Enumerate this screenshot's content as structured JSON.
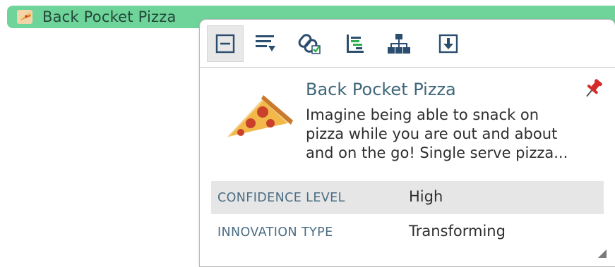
{
  "topic": {
    "title": "Back Pocket Pizza",
    "pill_color": "#6fd49a",
    "icon": "pizza-slice-icon"
  },
  "toolbar": {
    "tools": [
      {
        "icon": "collapse-icon",
        "active": true
      },
      {
        "icon": "filter-list-icon",
        "active": false
      },
      {
        "icon": "link-check-icon",
        "active": false
      },
      {
        "icon": "gantt-list-icon",
        "active": false
      },
      {
        "icon": "hierarchy-icon",
        "active": false
      },
      {
        "icon": "download-icon",
        "active": false
      }
    ]
  },
  "idea": {
    "title": "Back Pocket Pizza",
    "description_lines": [
      "Imagine being able to snack on",
      "pizza while you are out and about",
      "and on the go! Single serve pizza..."
    ],
    "pin_icon": "pin-icon",
    "pin_color": "#d42a2a"
  },
  "properties": [
    {
      "label": "CONFIDENCE LEVEL",
      "value": "High"
    },
    {
      "label": "INNOVATION TYPE",
      "value": "Transforming"
    }
  ]
}
